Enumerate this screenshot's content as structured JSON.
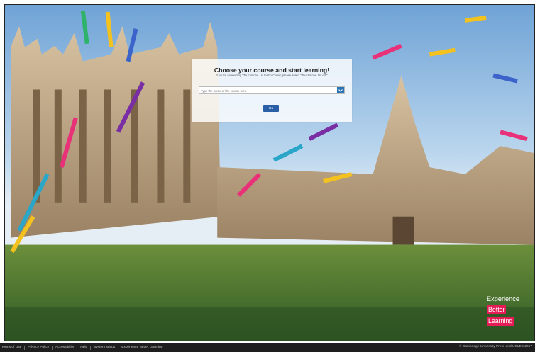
{
  "hero": {
    "title": "Choose your course and start learning!",
    "subtitle": "If you're an existing \"Touchstone 1st Edition\" user, please select \"Touchstone 1st ed.\"",
    "search_placeholder": "Type the name of the course here",
    "go_label": "Go"
  },
  "brand": {
    "line1": "Experience",
    "line2": "Better",
    "line3": "Learning"
  },
  "footer": {
    "links": [
      "Terms of Use",
      "Privacy Policy",
      "Accessibility",
      "Help",
      "System status",
      "Experience Better Learning"
    ],
    "copyright": "© Cambridge University Press and UCLES 2017"
  },
  "colors": {
    "accent_blue": "#2a5ea7",
    "brand_pink": "#e51c56",
    "footer_bg": "#1e1e1e"
  }
}
